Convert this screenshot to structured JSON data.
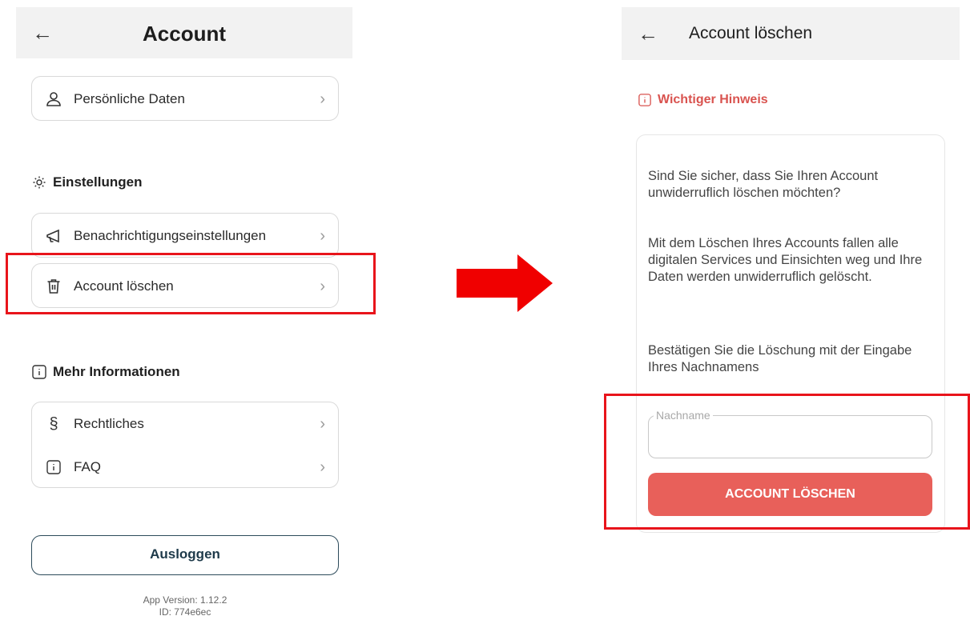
{
  "left": {
    "header": {
      "title": "Account"
    },
    "personal": {
      "label": "Persönliche Daten"
    },
    "settings": {
      "title": "Einstellungen",
      "items": [
        {
          "label": "Benachrichtigungseinstellungen"
        },
        {
          "label": "Account löschen"
        }
      ]
    },
    "info": {
      "title": "Mehr Informationen",
      "items": [
        {
          "label": "Rechtliches"
        },
        {
          "label": "FAQ"
        }
      ]
    },
    "logout": {
      "label": "Ausloggen"
    },
    "version": {
      "line1": "App Version: 1.12.2",
      "line2": "ID: 774e6ec"
    }
  },
  "right": {
    "header": {
      "title": "Account löschen"
    },
    "hint": {
      "title": "Wichtiger Hinweis"
    },
    "paragraphs": [
      "Sind Sie sicher, dass Sie Ihren Account unwiderruflich löschen möchten?",
      "Mit dem Löschen Ihres Accounts fallen alle digitalen Services und Einsichten weg und Ihre Daten werden unwiderruflich gelöscht.",
      "Bestätigen Sie die Löschung mit der Eingabe Ihres Nachnamens"
    ],
    "field": {
      "label": "Nachname",
      "value": ""
    },
    "button": {
      "label": "ACCOUNT LÖSCHEN"
    }
  },
  "colors": {
    "highlight": "#e8141b",
    "danger": "#e8605a",
    "hint": "#d9534f",
    "logout_border": "#2c4a5a"
  }
}
